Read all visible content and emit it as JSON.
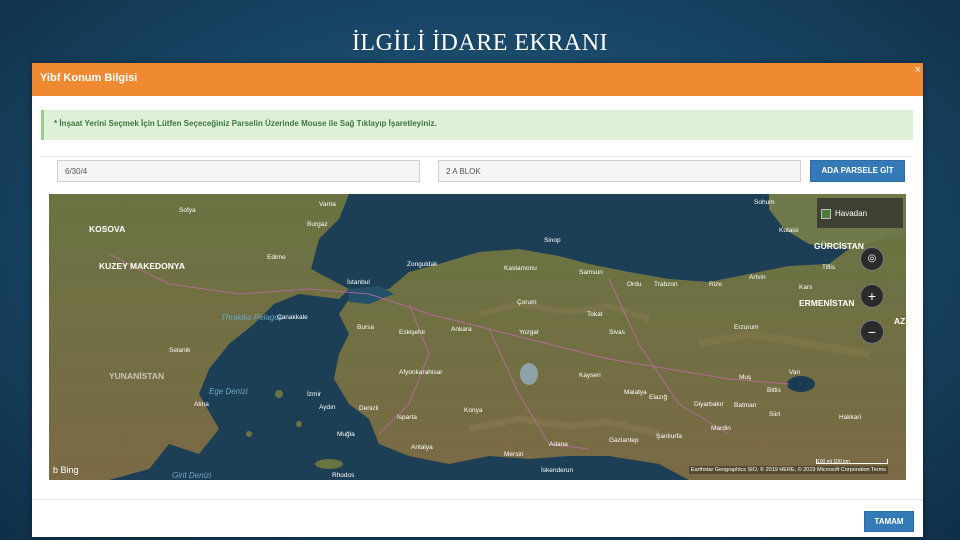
{
  "slide": {
    "title": "İLGİLİ İDARE EKRANI"
  },
  "dialog": {
    "title": "Yibf Konum Bilgisi",
    "close_label": "×",
    "alert": "* İnşaat Yerini Seçmek İçin Lütfen Seçeceğiniz Parselin Üzerinde Mouse ile Sağ Tıklayıp İşaretleyiniz.",
    "field_ada": "6/30/4",
    "field_parsel": "2 A BLOK",
    "goto_button": "ADA PARSELE GİT",
    "ok_button": "TAMAM"
  },
  "map": {
    "layer_label": "Havadan",
    "zoom_in": "+",
    "zoom_out": "−",
    "logo": "b Bing",
    "attribution": "Earthstar Geographics SIO, © 2019 HERE, © 2019 Microsoft Corporation Terms",
    "scale": "100 mi   100 km",
    "labels": {
      "sea_black": "",
      "kosova": "KOSOVA",
      "kuzey_makedonya": "KUZEY MAKEDONYA",
      "yunanistan": "YUNANİSTAN",
      "ege_denizi": "Ege Denizi",
      "thrakiko": "Thrakiko Pelagos",
      "gurcistan": "GÜRCİSTAN",
      "ermenistan": "ERMENİSTAN",
      "az": "AZ",
      "istanbul": "İstanbul",
      "ankara": "Ankara",
      "izmir": "İzmir",
      "antalya": "Antalya",
      "konya": "Konya",
      "bursa": "Bursa",
      "samsun": "Samsun",
      "trabzon": "Trabzon",
      "erzurum": "Erzurum",
      "kayseri": "Kayseri",
      "diyarbakir": "Diyarbakır",
      "van": "Van",
      "sinop": "Sinop",
      "zonguldak": "Zonguldak",
      "kastamonu": "Kastamonu",
      "malatya": "Malatya",
      "sivas": "Sivas",
      "eskisehir": "Eskişehir",
      "adana": "Adana",
      "mersin": "Mersin",
      "gaziantep": "Gaziantep",
      "sanliurfa": "Şanlıurfa",
      "atina": "Atina",
      "selanik": "Selanik",
      "sofya": "Sofya",
      "tiflis": "Tiflis",
      "rodos": "Rhodos",
      "kibris": "Girit Denizi",
      "edirne": "Edirne",
      "canakkale": "Çanakkale",
      "aydin": "Aydın",
      "denizli": "Denizli",
      "mugla": "Muğla",
      "afyon": "Afyonkarahisar",
      "batman": "Batman",
      "hakkari": "Hakkari",
      "kars": "Kars",
      "artvin": "Artvin",
      "rize": "Rize",
      "ordu": "Ordu",
      "tokat": "Tokat",
      "yozgat": "Yozgat",
      "corum": "Çorum",
      "isparta": "Isparta",
      "iskenderun": "İskenderun",
      "elazig": "Elazığ",
      "mus": "Muş",
      "bitlis": "Bitlis",
      "siirt": "Siirt",
      "mardin": "Mardin",
      "kutaisi": "Kutaisi",
      "sohum": "Sohum",
      "varna": "Varna",
      "burgaz": "Burgaz"
    }
  },
  "colors": {
    "header": "#ef8a33",
    "primary": "#337ab7",
    "alert_bg": "#dff0d8",
    "alert_text": "#3c763d",
    "sea": "#1d3f55",
    "land": "#5f6b3c"
  }
}
